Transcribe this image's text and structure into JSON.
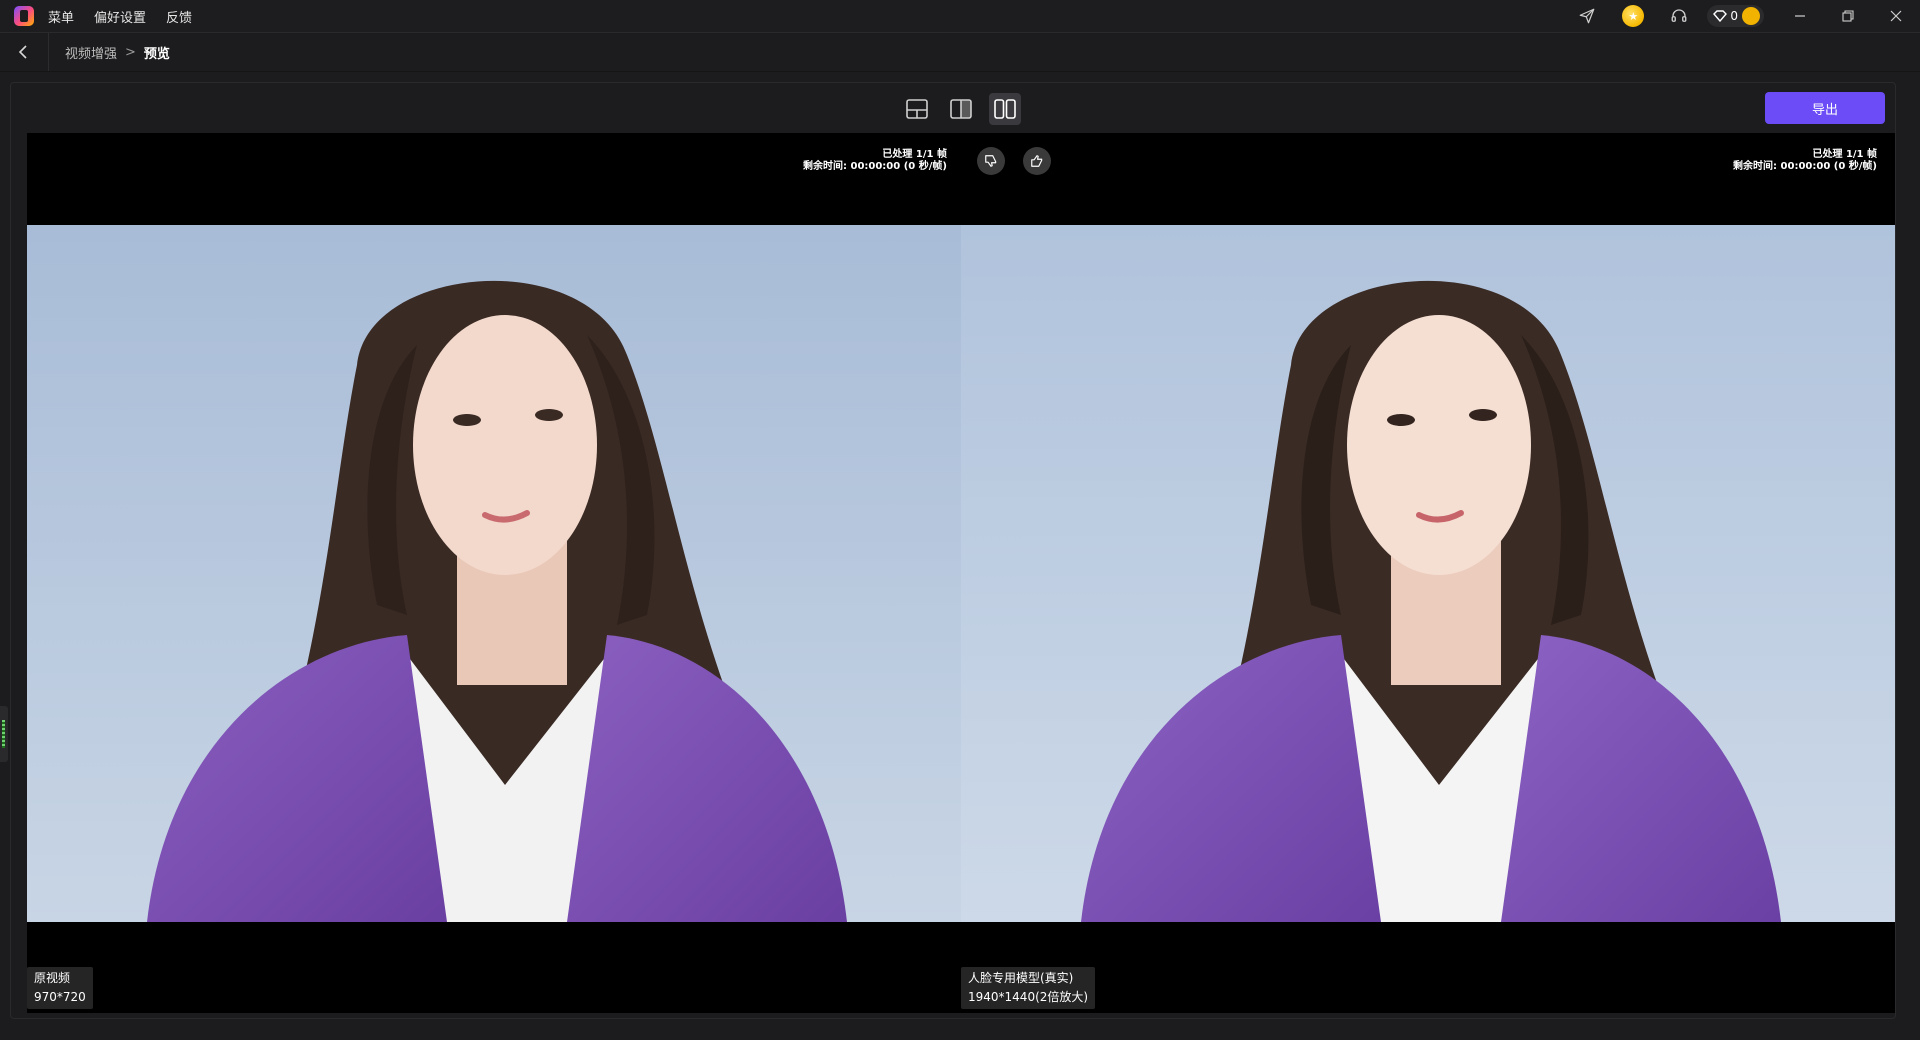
{
  "titlebar": {
    "menu": [
      "菜单",
      "偏好设置",
      "反馈"
    ],
    "vip_count": "0",
    "colors": {
      "accent": "#6b4cf6",
      "coin": "#f6b800"
    },
    "icons": [
      "app-logo-icon",
      "send-icon",
      "coin-icon",
      "headset-icon",
      "diamond-icon",
      "vip-badge-icon",
      "minimize-icon",
      "restore-icon",
      "close-icon"
    ]
  },
  "breadcrumb": {
    "parent": "视频增强",
    "separator": ">",
    "current": "预览"
  },
  "toolbar": {
    "export_label": "导出",
    "view_modes": [
      "split-horizontal",
      "split-vertical",
      "side-by-side"
    ],
    "active_view": "side-by-side"
  },
  "preview": {
    "left_status": {
      "processed": "已处理 1/1 帧",
      "remaining": "剩余时间: 00:00:00 (0 秒/帧)"
    },
    "right_status": {
      "processed": "已处理 1/1 帧",
      "remaining": "剩余时间: 00:00:00 (0 秒/帧)"
    },
    "original": {
      "label": "原视频",
      "resolution": "970*720"
    },
    "enhanced": {
      "label": "人脸专用模型(真实)",
      "resolution": "1940*1440(2倍放大)"
    }
  }
}
